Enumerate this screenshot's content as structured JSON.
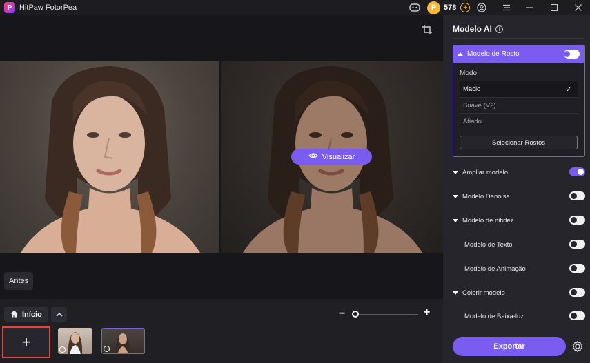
{
  "app": {
    "title": "HitPaw FotorPea"
  },
  "titlebar": {
    "credits": "578",
    "icons": [
      "discord-icon",
      "coin-icon",
      "add-credits-icon",
      "account-icon",
      "menu-icon",
      "minimize-icon",
      "maximize-icon",
      "close-icon"
    ]
  },
  "canvas": {
    "preview_label": "Visualizar",
    "before_label": "Antes"
  },
  "bottom": {
    "home_label": "Início",
    "add_label": "+"
  },
  "panel": {
    "title": "Modelo AI",
    "face_model": {
      "label": "Modelo de Rosto",
      "enabled": true,
      "mode_label": "Modo",
      "options": [
        "Macio",
        "Suave (V2)",
        "Afiado"
      ],
      "selected": "Macio",
      "select_faces_label": "Selecionar Rostos"
    },
    "models": [
      {
        "label": "Ampliar modelo",
        "expandable": true,
        "enabled": true
      },
      {
        "label": "Modelo Denoise",
        "expandable": true,
        "enabled": false
      },
      {
        "label": "Modelo de nitidez",
        "expandable": true,
        "enabled": false
      },
      {
        "label": "Modelo de Texto",
        "expandable": false,
        "enabled": false
      },
      {
        "label": "Modelo de Animação",
        "expandable": false,
        "enabled": false
      },
      {
        "label": "Colorir modelo",
        "expandable": true,
        "enabled": false
      },
      {
        "label": "Modelo de Baixa-luz",
        "expandable": false,
        "enabled": false
      }
    ],
    "export_label": "Exportar"
  },
  "colors": {
    "accent": "#7a5cf0",
    "highlight_border": "#e8463c",
    "coin": "#f4b73a"
  }
}
